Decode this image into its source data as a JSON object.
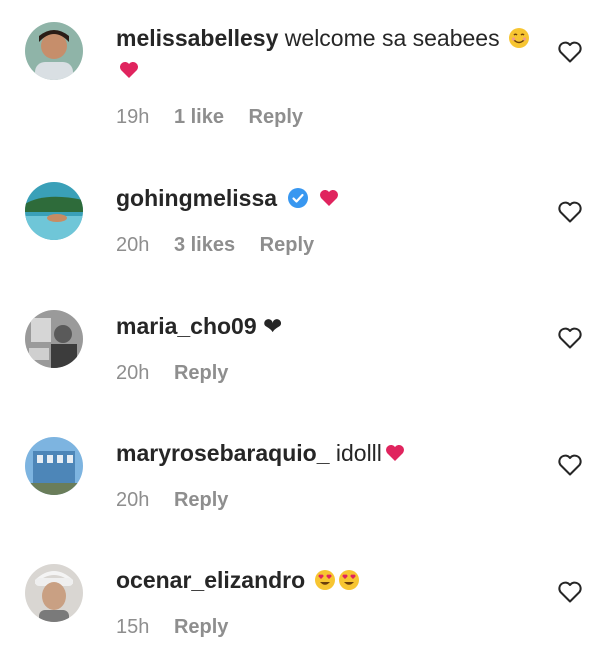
{
  "comments": [
    {
      "username": "melissabellesy",
      "text": "welcome sa seabees",
      "emojis": [
        "smiling-face-emoji",
        "red-heart-emoji"
      ],
      "time": "19h",
      "likes": "1 like",
      "reply": "Reply",
      "verified": false,
      "avatar": "woman-portrait-avatar"
    },
    {
      "username": "gohingmelissa",
      "text": "",
      "emojis": [
        "red-heart-emoji"
      ],
      "time": "20h",
      "likes": "3 likes",
      "reply": "Reply",
      "verified": true,
      "avatar": "pool-photo-avatar"
    },
    {
      "username": "maria_cho09",
      "text": "❤",
      "emojis": [],
      "time": "20h",
      "likes": "",
      "reply": "Reply",
      "verified": false,
      "avatar": "grayscale-photo-avatar"
    },
    {
      "username": "maryrosebaraquio_",
      "text": "idolll",
      "emojis": [
        "red-heart-emoji"
      ],
      "time": "20h",
      "likes": "",
      "reply": "Reply",
      "verified": false,
      "avatar": "building-photo-avatar"
    },
    {
      "username": "ocenar_elizandro",
      "text": "",
      "emojis": [
        "heart-eyes-emoji",
        "heart-eyes-emoji"
      ],
      "time": "15h",
      "likes": "",
      "reply": "Reply",
      "verified": false,
      "avatar": "person-cap-avatar"
    }
  ],
  "colors": {
    "text": "#262626",
    "meta": "#8e8e8e",
    "verified": "#3897f0",
    "heart": "#e0245e"
  }
}
